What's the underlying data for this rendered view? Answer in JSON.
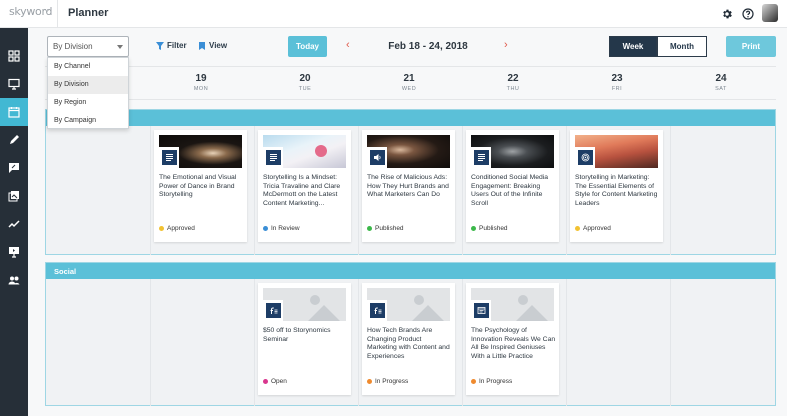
{
  "app": {
    "brand": "skyword",
    "title": "Planner"
  },
  "icons": {
    "settings": "gear-icon",
    "help": "help-icon",
    "avatar": "user-avatar",
    "sidebar": [
      "grid-icon",
      "monitor-icon",
      "calendar-icon",
      "pencil-icon",
      "chat-edit-icon",
      "gallery-icon",
      "analytics-icon",
      "presentation-icon",
      "users-icon"
    ]
  },
  "toolbar": {
    "group_by": "By Division",
    "filter_label": "Filter",
    "view_label": "View",
    "today_label": "Today",
    "date_range": "Feb 18 - 24, 2018",
    "week_label": "Week",
    "month_label": "Month",
    "print_label": "Print"
  },
  "group_menu": [
    "By Channel",
    "By Division",
    "By Region",
    "By Campaign"
  ],
  "days": [
    {
      "num": "19",
      "dow": "MON"
    },
    {
      "num": "20",
      "dow": "TUE"
    },
    {
      "num": "21",
      "dow": "WED"
    },
    {
      "num": "22",
      "dow": "THU"
    },
    {
      "num": "23",
      "dow": "FRI"
    },
    {
      "num": "24",
      "dow": "SAT"
    }
  ],
  "status_colors": {
    "Approved": "#f2c232",
    "In Review": "#3a8ed6",
    "Published": "#3cb84a",
    "Open": "#d9368e",
    "In Progress": "#ef8a2e"
  },
  "groups": [
    {
      "name": "",
      "cards": [
        {
          "title": "The Emotional and Visual Power of Dance in Brand Storytelling",
          "status": "Approved",
          "type": "article-icon"
        },
        {
          "title": "Storytelling Is a Mindset: Tricia Travaline and Clare McDermott on the Latest Content Marketing...",
          "status": "In Review",
          "type": "article-icon"
        },
        {
          "title": "The Rise of Malicious Ads: How They Hurt Brands and What Marketers Can Do",
          "status": "Published",
          "type": "audio-icon"
        },
        {
          "title": "Conditioned Social Media Engagement: Breaking Users Out of the Infinite Scroll",
          "status": "Published",
          "type": "article-icon"
        },
        {
          "title": "Storytelling in Marketing: The Essential Elements of Style for Content Marketing Leaders",
          "status": "Approved",
          "type": "podcast-icon"
        }
      ]
    },
    {
      "name": "Social",
      "cards": [
        {
          "title": "$50 off to Storynomics Seminar",
          "status": "Open",
          "type": "facebook-post-icon"
        },
        {
          "title": "How Tech Brands Are Changing Product Marketing with Content and Experiences",
          "status": "In Progress",
          "type": "facebook-post-icon"
        },
        {
          "title": "The Psychology of Innovation Reveals We Can All Be Inspired Geniuses With a Little Practice",
          "status": "In Progress",
          "type": "web-post-icon"
        }
      ]
    }
  ]
}
